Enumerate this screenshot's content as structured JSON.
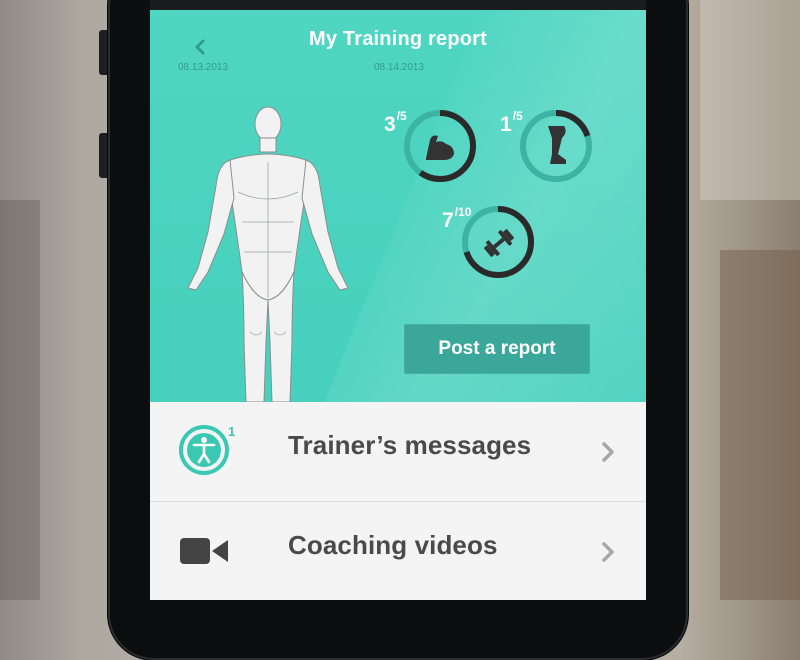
{
  "header": {
    "title": "My Training report",
    "date_left": "08.13.2013",
    "date_right": "08.14.2013"
  },
  "stats": [
    {
      "value": "3",
      "total": "/5",
      "icon": "biceps-icon",
      "progress": 0.6
    },
    {
      "value": "1",
      "total": "/5",
      "icon": "leg-icon",
      "progress": 0.2
    },
    {
      "value": "7",
      "total": "/10",
      "icon": "dumbbell-icon",
      "progress": 0.7
    }
  ],
  "actions": {
    "post_report": "Post a report"
  },
  "list": [
    {
      "label": "Trainer’s messages",
      "icon": "accessibility-person-icon",
      "badge": "1"
    },
    {
      "label": "Coaching videos",
      "icon": "video-camera-icon",
      "badge": ""
    }
  ],
  "colors": {
    "accent": "#4fd6c2",
    "button": "#3aa79a",
    "list_text": "#4a4a4a",
    "ring_track": "#3cb3a3",
    "ring_fill": "#2a2a2a"
  }
}
